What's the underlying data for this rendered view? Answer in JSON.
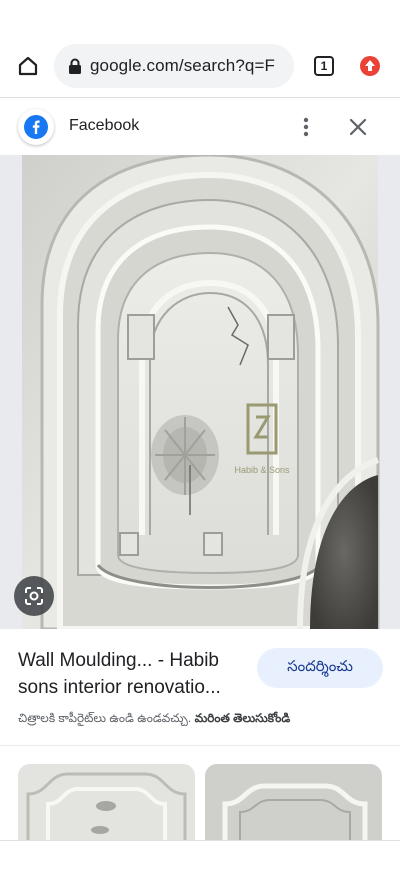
{
  "browser": {
    "url": "google.com/search?q=F",
    "tab_count": "1"
  },
  "source": {
    "name": "Facebook"
  },
  "result": {
    "title": "Wall Moulding... - Habib sons interior renovatio...",
    "visit_label": "సందర్శించు",
    "copyright_notice": "చిత్రాలకి కాపీరైట్‌లు ఉండి ఉండవచ్చు.",
    "learn_more": "మరింత తెలుసుకోండి"
  },
  "image": {
    "watermark_text": "Habib & Sons"
  },
  "colors": {
    "accent": "#1a73e8",
    "visit_bg": "#e8f0fe",
    "facebook": "#1877f2",
    "extension": "#ea4335"
  }
}
